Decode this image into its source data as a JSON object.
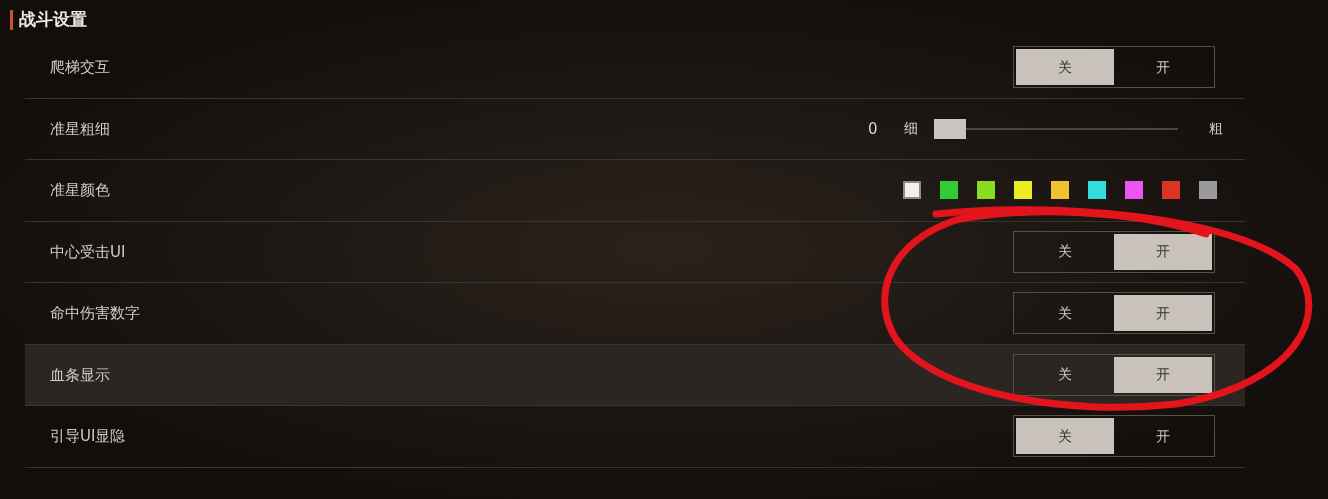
{
  "section_title": "战斗设置",
  "rows": [
    {
      "kind": "toggle",
      "label": "爬梯交互",
      "hovered": false,
      "options": [
        {
          "label": "关",
          "selected": true
        },
        {
          "label": "开",
          "selected": false
        }
      ]
    },
    {
      "kind": "slider",
      "label": "准星粗细",
      "hovered": false,
      "value": "0",
      "min_label": "细",
      "max_label": "粗",
      "level": 0
    },
    {
      "kind": "colors",
      "label": "准星颜色",
      "hovered": false,
      "swatches": [
        {
          "color": "#f2f2f2",
          "selected": true
        },
        {
          "color": "#33cc33",
          "selected": false
        },
        {
          "color": "#88dd22",
          "selected": false
        },
        {
          "color": "#e8ee22",
          "selected": false
        },
        {
          "color": "#f0c030",
          "selected": false
        },
        {
          "color": "#33dddd",
          "selected": false
        },
        {
          "color": "#ee55ee",
          "selected": false
        },
        {
          "color": "#dd3322",
          "selected": false
        },
        {
          "color": "#9a9a9a",
          "selected": false
        }
      ]
    },
    {
      "kind": "toggle",
      "label": "中心受击UI",
      "hovered": false,
      "options": [
        {
          "label": "关",
          "selected": false
        },
        {
          "label": "开",
          "selected": true
        }
      ]
    },
    {
      "kind": "toggle",
      "label": "命中伤害数字",
      "hovered": false,
      "options": [
        {
          "label": "关",
          "selected": false
        },
        {
          "label": "开",
          "selected": true
        }
      ]
    },
    {
      "kind": "toggle",
      "label": "血条显示",
      "hovered": true,
      "options": [
        {
          "label": "关",
          "selected": false
        },
        {
          "label": "开",
          "selected": true
        }
      ]
    },
    {
      "kind": "toggle",
      "label": "引导UI显隐",
      "hovered": false,
      "options": [
        {
          "label": "关",
          "selected": true
        },
        {
          "label": "开",
          "selected": false
        }
      ]
    }
  ]
}
